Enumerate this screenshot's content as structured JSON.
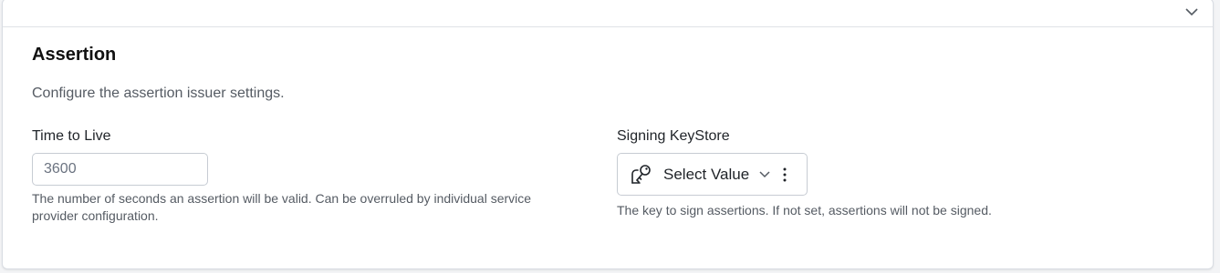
{
  "section": {
    "title": "Assertion",
    "description": "Configure the assertion issuer settings."
  },
  "time_to_live": {
    "label": "Time to Live",
    "value": "3600",
    "help": "The number of seconds an assertion will be valid. Can be overruled by individual service provider configuration."
  },
  "signing_keystore": {
    "label": "Signing KeyStore",
    "selected": "Select Value",
    "help": "The key to sign assertions. If not set, assertions will not be signed.",
    "icon": "key-icon"
  },
  "icons": {
    "collapse": "chevron-down-icon",
    "more": "more-vertical-icon"
  }
}
